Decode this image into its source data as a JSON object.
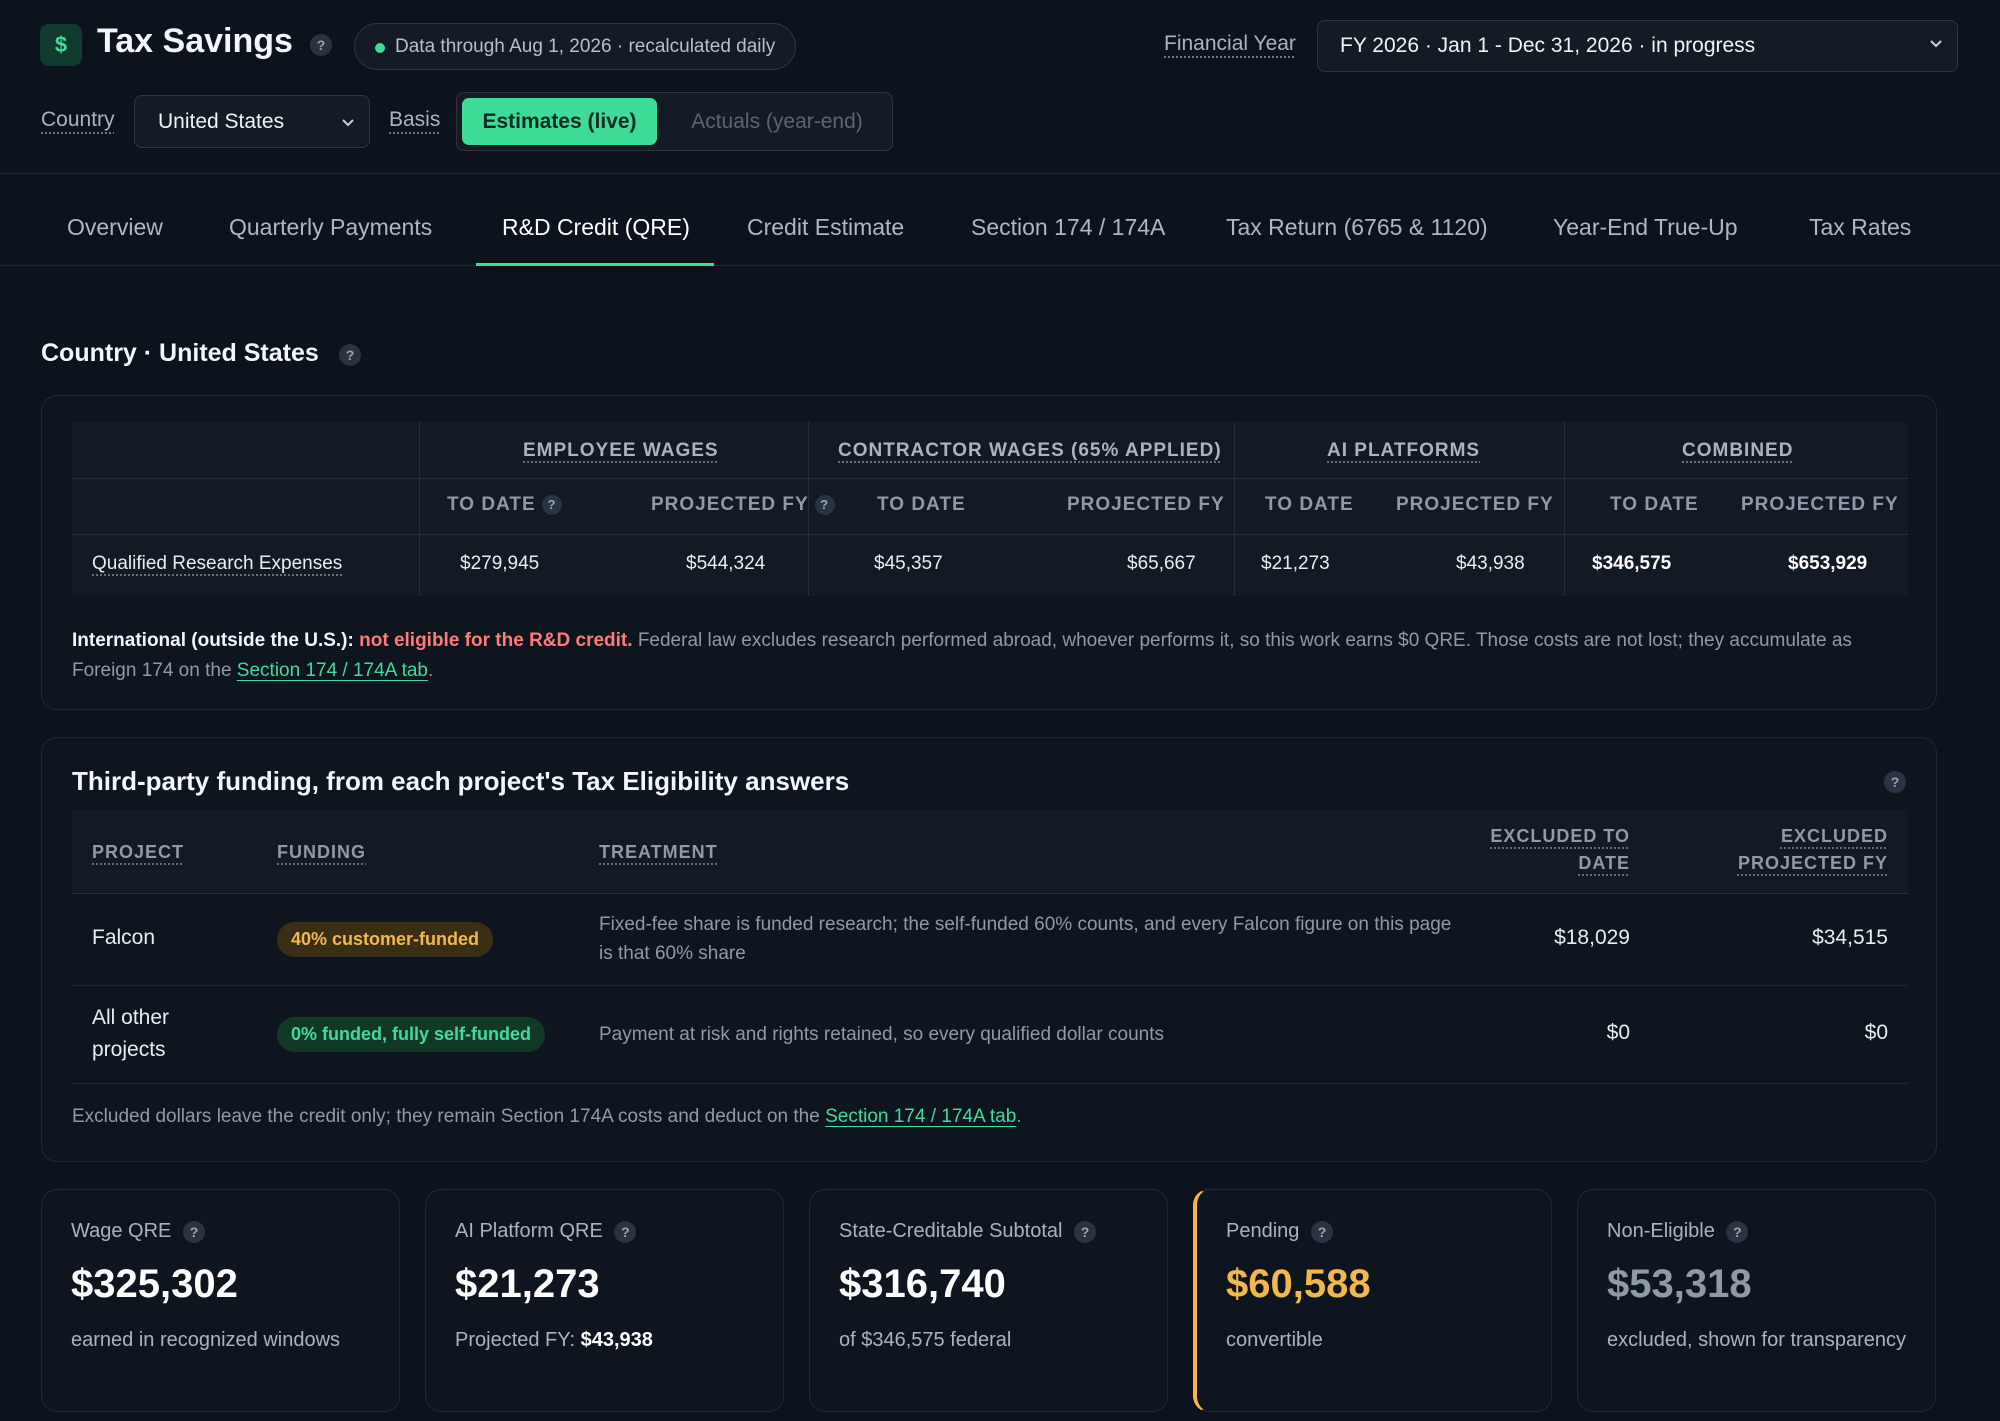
{
  "header": {
    "logo_glyph": "$",
    "title": "Tax Savings",
    "help_glyph": "?",
    "status_text": "Data through Aug 1, 2026 · recalculated daily",
    "financial_year_label": "Financial Year",
    "financial_year_value": "FY 2026 · Jan 1 - Dec 31, 2026 · in progress",
    "country_label": "Country",
    "country_value": "United States",
    "basis_label": "Basis",
    "basis_options": [
      "Estimates (live)",
      "Actuals (year-end)"
    ],
    "basis_selected": "Estimates (live)"
  },
  "tabs": [
    {
      "label": "Overview"
    },
    {
      "label": "Quarterly Payments"
    },
    {
      "label": "R&D Credit (QRE)",
      "active": true
    },
    {
      "label": "Credit Estimate"
    },
    {
      "label": "Section 174 / 174A"
    },
    {
      "label": "Tax Return (6765 & 1120)"
    },
    {
      "label": "Year-End True-Up"
    },
    {
      "label": "Tax Rates"
    }
  ],
  "section_title": "Country · United States",
  "qre_table": {
    "groups": [
      "EMPLOYEE WAGES",
      "CONTRACTOR WAGES (65% APPLIED)",
      "AI PLATFORMS",
      "COMBINED"
    ],
    "subheaders": [
      "TO DATE",
      "PROJECTED FY",
      "TO DATE",
      "PROJECTED FY",
      "TO DATE",
      "PROJECTED FY",
      "TO DATE",
      "PROJECTED FY"
    ],
    "row_label": "Qualified Research Expenses",
    "values": [
      "$279,945",
      "$544,324",
      "$45,357",
      "$65,667",
      "$21,273",
      "$43,938",
      "$346,575",
      "$653,929"
    ]
  },
  "international_note": {
    "lead": "International (outside the U.S.):",
    "warning": "not eligible for the R&D credit.",
    "body": "Federal law excludes research performed abroad, whoever performs it, so this work earns $0 QRE. Those costs are not lost; they accumulate as Foreign 174 on the",
    "link": "Section 174 / 174A tab",
    "end": "."
  },
  "funding": {
    "title": "Third-party funding, from each project's Tax Eligibility answers",
    "headers": {
      "project": "PROJECT",
      "funding": "FUNDING",
      "treatment": "TREATMENT",
      "excluded_to_date_1": "EXCLUDED TO",
      "excluded_to_date_2": "DATE",
      "excluded_fy_1": "EXCLUDED",
      "excluded_fy_2": "PROJECTED FY"
    },
    "rows": [
      {
        "project": "Falcon",
        "badge": "40% customer-funded",
        "treatment": "Fixed-fee share is funded research; the self-funded 60% counts, and every Falcon figure on this page is that 60% share",
        "excluded_to_date": "$18,029",
        "excluded_fy": "$34,515"
      },
      {
        "project_1": "All other",
        "project_2": "projects",
        "badge": "0% funded, fully self-funded",
        "treatment": "Payment at risk and rights retained, so every qualified dollar counts",
        "excluded_to_date": "$0",
        "excluded_fy": "$0"
      }
    ],
    "note": "Excluded dollars leave the credit only; they remain Section 174A costs and deduct on the",
    "note_link": "Section 174 / 174A tab",
    "note_end": "."
  },
  "metrics": [
    {
      "label": "Wage QRE",
      "value": "$325,302",
      "desc": "earned in recognized windows"
    },
    {
      "label": "AI Platform QRE",
      "value": "$21,273",
      "desc": "Projected FY:",
      "desc_bold": "$43,938"
    },
    {
      "label": "State-Creditable Subtotal",
      "value": "$316,740",
      "desc": "of $346,575 federal"
    },
    {
      "label": "Pending",
      "value": "$60,588",
      "desc": "convertible"
    },
    {
      "label": "Non-Eligible",
      "value": "$53,318",
      "desc": "excluded, shown for transparency"
    }
  ],
  "colors": {
    "accent": "#3ddc97",
    "pending": "#f2b84b",
    "warning": "#ff7a7a",
    "background": "#0d131c"
  }
}
